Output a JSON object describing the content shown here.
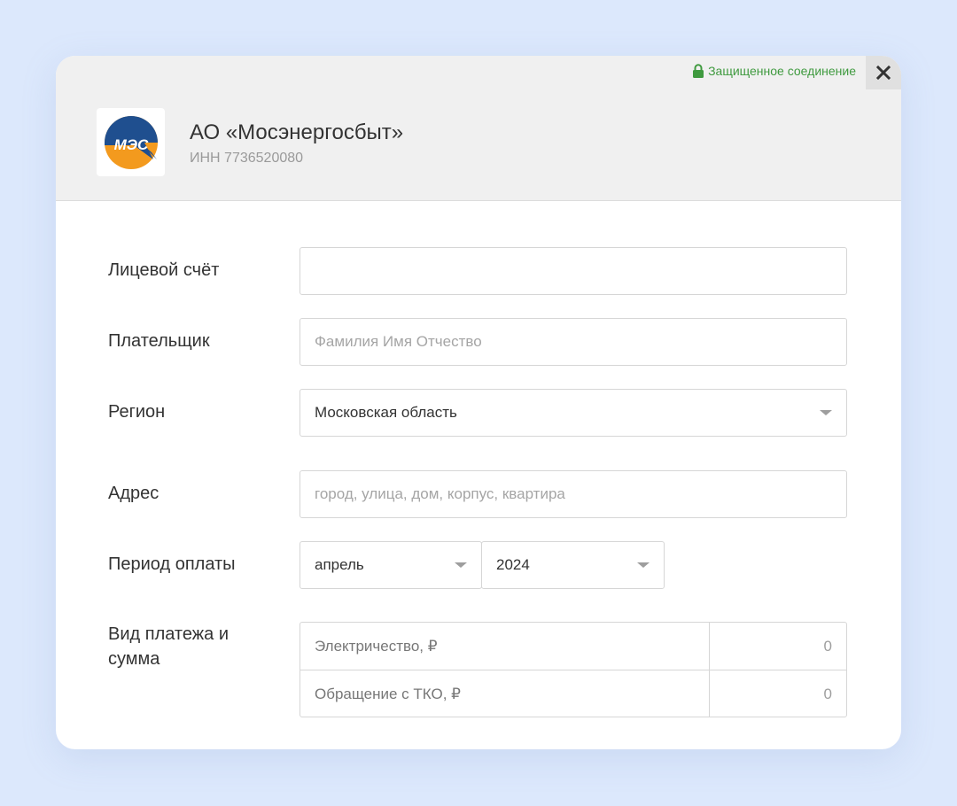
{
  "header": {
    "secure_text": "Защищенное соединение",
    "close_symbol": "✕",
    "org_name": "АО «Мосэнергосбыт»",
    "org_inn": "ИНН 7736520080",
    "logo_text": "МЭС"
  },
  "form": {
    "account": {
      "label": "Лицевой счёт",
      "value": ""
    },
    "payer": {
      "label": "Плательщик",
      "placeholder": "Фамилия Имя Отчество"
    },
    "region": {
      "label": "Регион",
      "value": "Московская область"
    },
    "address": {
      "label": "Адрес",
      "placeholder": "город, улица, дом, корпус, квартира"
    },
    "period": {
      "label": "Период оплаты",
      "month": "апрель",
      "year": "2024"
    },
    "payment": {
      "label": "Вид платежа и сумма",
      "rows": [
        {
          "name": "Электричество, ₽",
          "amount": "0"
        },
        {
          "name": "Обращение с ТКО, ₽",
          "amount": "0"
        }
      ]
    }
  },
  "colors": {
    "background": "#dce8fc",
    "header_bg": "#f0f0f0",
    "secure_green": "#3f9a3f",
    "logo_blue": "#1f4f8f",
    "logo_orange": "#f39a1e"
  }
}
